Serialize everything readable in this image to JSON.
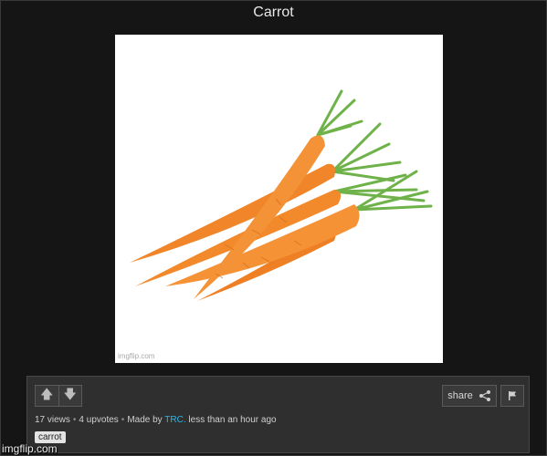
{
  "post": {
    "title": "Carrot",
    "image_watermark": "imgflip.com",
    "views": "17 views",
    "upvotes": "4 upvotes",
    "made_by_label": "Made by",
    "author": "TRC.",
    "time_ago": "less than an hour ago",
    "tag": "carrot"
  },
  "actions": {
    "share_label": "share",
    "upvote_icon": "arrow-up-icon",
    "downvote_icon": "arrow-down-icon",
    "share_icon": "share-icon",
    "flag_icon": "flag-icon"
  },
  "page_watermark": "imgflip.com",
  "colors": {
    "background": "#151515",
    "panel": "#2f2f2f",
    "author_link": "#2bb7e8"
  }
}
